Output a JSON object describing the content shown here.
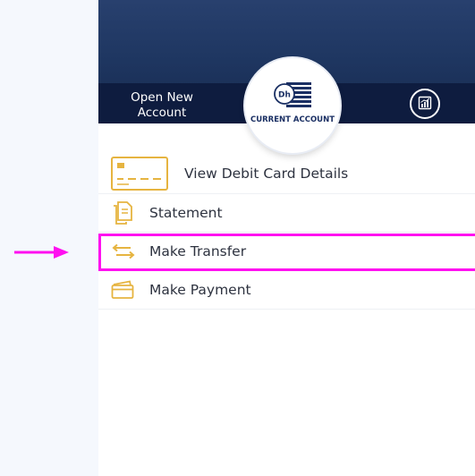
{
  "header": {
    "open_account_label": "Open New Account",
    "badge_logo_text": "Dh",
    "badge_label": "CURRENT ACCOUNT"
  },
  "menu": {
    "items": [
      {
        "label": "View Debit Card Details",
        "icon": "debit-card-icon"
      },
      {
        "label": "Statement",
        "icon": "statement-icon"
      },
      {
        "label": "Make Transfer",
        "icon": "transfer-icon"
      },
      {
        "label": "Make Payment",
        "icon": "payment-icon"
      }
    ]
  },
  "colors": {
    "header_dark": "#16294e",
    "accent_gold": "#e6b440",
    "highlight": "#ff10f0",
    "text": "#2e3340"
  }
}
